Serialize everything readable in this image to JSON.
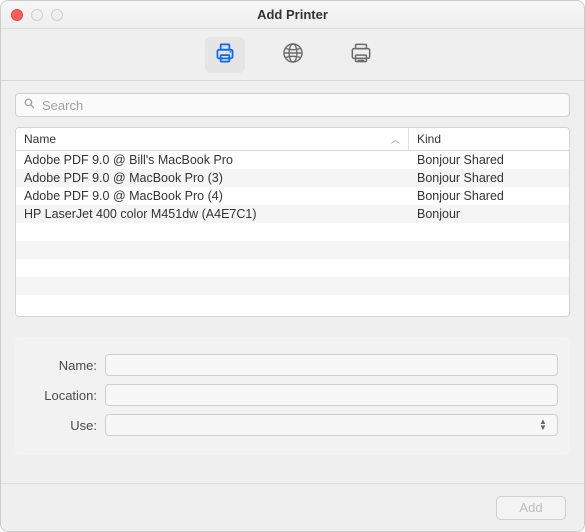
{
  "window": {
    "title": "Add Printer"
  },
  "toolbar": {
    "tabs": [
      {
        "name": "default-printer-icon",
        "active": true
      },
      {
        "name": "ip-printer-icon",
        "active": false
      },
      {
        "name": "windows-printer-icon",
        "active": false
      }
    ]
  },
  "search": {
    "placeholder": "Search",
    "value": ""
  },
  "list": {
    "columns": {
      "name": "Name",
      "kind": "Kind"
    },
    "rows": [
      {
        "name": "Adobe PDF 9.0 @ Bill's MacBook Pro",
        "kind": "Bonjour Shared"
      },
      {
        "name": "Adobe PDF 9.0 @ MacBook Pro (3)",
        "kind": "Bonjour Shared"
      },
      {
        "name": "Adobe PDF 9.0 @ MacBook Pro (4)",
        "kind": "Bonjour Shared"
      },
      {
        "name": "HP LaserJet 400 color M451dw (A4E7C1)",
        "kind": "Bonjour"
      }
    ]
  },
  "form": {
    "labels": {
      "name": "Name:",
      "location": "Location:",
      "use": "Use:"
    },
    "values": {
      "name": "",
      "location": "",
      "use": ""
    }
  },
  "footer": {
    "add_label": "Add"
  }
}
